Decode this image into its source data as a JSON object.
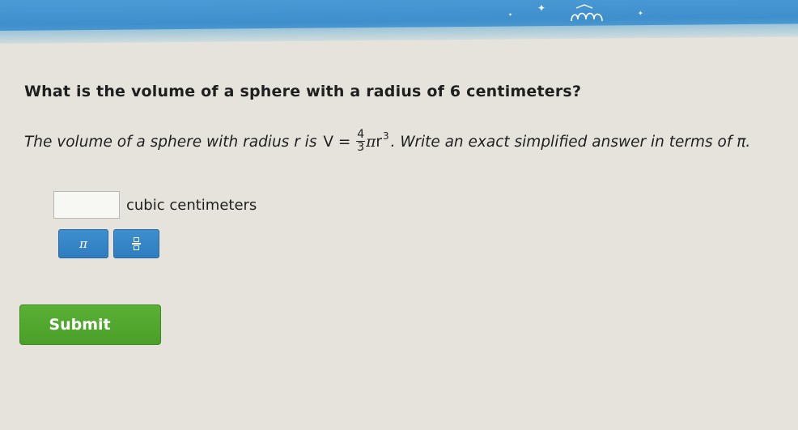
{
  "question": {
    "text": "What is the volume of a sphere with a radius of 6 centimeters?"
  },
  "instructions": {
    "prefix": "The volume of a sphere with radius r is ",
    "formula_lhs": "V = ",
    "fraction_numerator": "4",
    "fraction_denominator": "3",
    "formula_pi": "π",
    "formula_var": "r",
    "formula_exponent": "3",
    "suffix": ". Write an exact simplified answer in terms of π."
  },
  "answer": {
    "value": "",
    "unit": "cubic centimeters"
  },
  "toolbar": {
    "pi_label": "π"
  },
  "submit": {
    "label": "Submit"
  },
  "colors": {
    "header_blue": "#4a9bd6",
    "tool_button_blue": "#2f7dbe",
    "submit_green": "#4aa028",
    "page_background": "#e6e3dc"
  }
}
